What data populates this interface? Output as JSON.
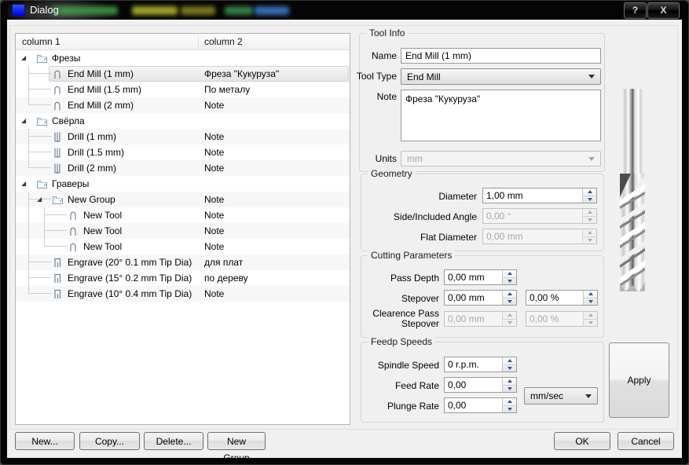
{
  "window": {
    "title": "Dialog",
    "help_glyph": "?",
    "close_glyph": "X",
    "titlebar_artifact_colors": [
      "#3f9b4a",
      "#b7bd2e",
      "#8a8a22",
      "#3e8f52",
      "#3d7fd4"
    ]
  },
  "tree": {
    "columns": [
      "column 1",
      "column 2"
    ],
    "rows": [
      {
        "label": "Фрезы",
        "note": "",
        "icon": "group",
        "depth": 0,
        "arrow": true
      },
      {
        "label": "End Mill (1 mm)",
        "note": "Фреза \"Кукуруза\"",
        "icon": "endmill",
        "depth": 1,
        "conn": {
          "x": 16,
          "last": false
        },
        "selected": true
      },
      {
        "label": "End Mill (1.5 mm)",
        "note": "По металу",
        "icon": "endmill",
        "depth": 1,
        "conn": {
          "x": 16,
          "last": false
        }
      },
      {
        "label": "End Mill (2 mm)",
        "note": "Note",
        "icon": "endmill",
        "depth": 1,
        "conn": {
          "x": 16,
          "last": true
        }
      },
      {
        "label": "Свёрла",
        "note": "",
        "icon": "group",
        "depth": 0,
        "arrow": true
      },
      {
        "label": "Drill (1 mm)",
        "note": "Note",
        "icon": "drill",
        "depth": 1,
        "conn": {
          "x": 16,
          "last": false
        }
      },
      {
        "label": "Drill (1.5 mm)",
        "note": "Note",
        "icon": "drill",
        "depth": 1,
        "conn": {
          "x": 16,
          "last": false
        }
      },
      {
        "label": "Drill (2 mm)",
        "note": "Note",
        "icon": "drill",
        "depth": 1,
        "conn": {
          "x": 16,
          "last": true
        }
      },
      {
        "label": "Граверы",
        "note": "",
        "icon": "group",
        "depth": 0,
        "arrow": true
      },
      {
        "label": "New Group",
        "note": "Note",
        "icon": "group",
        "depth": 1,
        "arrow": true,
        "conn": {
          "x": 16,
          "last": false
        }
      },
      {
        "label": "New Tool",
        "note": "Note",
        "icon": "endmill",
        "depth": 2,
        "guides": [
          16
        ],
        "conn": {
          "x": 36,
          "last": false
        }
      },
      {
        "label": "New Tool",
        "note": "Note",
        "icon": "endmill",
        "depth": 2,
        "guides": [
          16
        ],
        "conn": {
          "x": 36,
          "last": false
        }
      },
      {
        "label": "New Tool",
        "note": "Note",
        "icon": "endmill",
        "depth": 2,
        "guides": [
          16
        ],
        "conn": {
          "x": 36,
          "last": true
        }
      },
      {
        "label": "Engrave (20° 0.1 mm Tip Dia)",
        "note": "для плат",
        "icon": "engrave",
        "depth": 1,
        "conn": {
          "x": 16,
          "last": false
        }
      },
      {
        "label": "Engrave (15° 0.2 mm Tip Dia)",
        "note": "по дереву",
        "icon": "engrave",
        "depth": 1,
        "conn": {
          "x": 16,
          "last": false
        }
      },
      {
        "label": "Engrave (10° 0.4 mm Tip Dia)",
        "note": "Note",
        "icon": "engrave",
        "depth": 1,
        "conn": {
          "x": 16,
          "last": true
        }
      }
    ]
  },
  "tool_info": {
    "title": "Tool Info",
    "name_label": "Name",
    "name_value": "End Mill (1 mm)",
    "tool_type_label": "Tool Type",
    "tool_type_value": "End Mill",
    "note_label": "Note",
    "note_value": "Фреза \"Кукуруза\"",
    "units_label": "Units",
    "units_value": "mm"
  },
  "geometry": {
    "title": "Geometry",
    "fields": [
      {
        "label": "Diameter",
        "value": "1,00 mm",
        "disabled": false
      },
      {
        "label": "Side/Included Angle",
        "value": "0,00 °",
        "disabled": true
      },
      {
        "label": "Flat Diameter",
        "value": "0,00 mm",
        "disabled": true
      }
    ]
  },
  "cutting": {
    "title": "Cutting Parameters",
    "rows": [
      {
        "label": "Pass Depth",
        "value1": "0,00 mm",
        "value2": "",
        "disabled": false
      },
      {
        "label": "Stepover",
        "value1": "0,00 mm",
        "value2": "0,00 %",
        "disabled": false
      },
      {
        "label": "Clearence Pass Stepover",
        "value1": "0,00 mm",
        "value2": "0,00 %",
        "disabled": true
      }
    ]
  },
  "feeds": {
    "title": "Feedp Speeds",
    "rows": [
      {
        "label": "Spindle Speed",
        "value": "0 r.p.m."
      },
      {
        "label": "Feed Rate",
        "value": "0,00"
      },
      {
        "label": "Plunge Rate",
        "value": "0,00"
      }
    ],
    "units_value": "mm/sec"
  },
  "buttons": {
    "new": "New...",
    "copy": "Copy...",
    "delete": "Delete...",
    "new_group": "New Group",
    "apply": "Apply",
    "ok": "OK",
    "cancel": "Cancel"
  }
}
